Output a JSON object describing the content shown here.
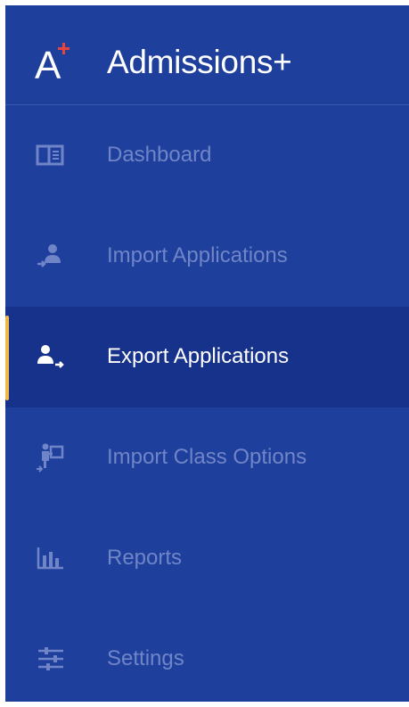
{
  "app": {
    "title": "Admissions+",
    "logo_text": "A",
    "logo_plus": "+"
  },
  "colors": {
    "sidebar_bg": "#1f3f9c",
    "active_bg": "#17328a",
    "active_indicator": "#f0b84a",
    "inactive_text": "#6f85c7",
    "active_text": "#ffffff",
    "logo_plus": "#e8433c"
  },
  "nav": {
    "items": [
      {
        "label": "Dashboard",
        "icon": "dashboard-icon",
        "active": false
      },
      {
        "label": "Import Applications",
        "icon": "import-user-icon",
        "active": false
      },
      {
        "label": "Export Applications",
        "icon": "export-user-icon",
        "active": true
      },
      {
        "label": "Import Class Options",
        "icon": "import-class-icon",
        "active": false
      },
      {
        "label": "Reports",
        "icon": "bar-chart-icon",
        "active": false
      },
      {
        "label": "Settings",
        "icon": "sliders-icon",
        "active": false
      }
    ]
  }
}
